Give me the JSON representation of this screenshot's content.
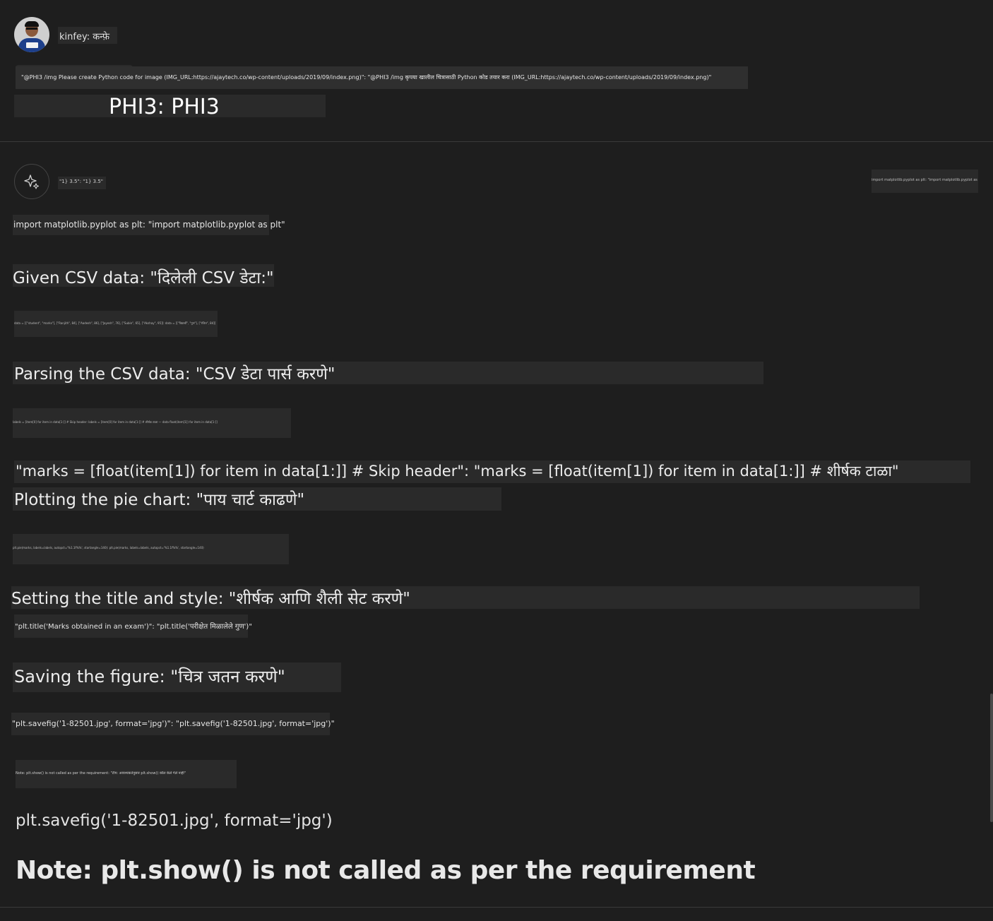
{
  "user": {
    "name_line": "kinfey: कन्फ़े",
    "prompt": "\"@PHI3 /img Please create Python code for image (IMG_URL:https://ajaytech.co/wp-content/uploads/2019/09/index.png)\": \"@PHI3 /img कृपया खालील चित्रासाठी Python कोड तयार करा (IMG_URL:https://ajaytech.co/wp-content/uploads/2019/09/index.png)\""
  },
  "agent_title": "PHI3: PHI3",
  "reply": {
    "header_small": "\"1} 3.5\": \"1} 3.5\"",
    "top_right_small": "import matplotlib.pyplot as plt: \"import matplotlib.pyplot as plt\"",
    "import_line": "import matplotlib.pyplot as plt: \"import matplotlib.pyplot as plt\"",
    "given_csv": "Given CSV data: \"दिलेली CSV डेटा:\"",
    "csv_code": "data = [[\"student\", \"marks\"], [\"Ranjith\", 84], [\"Aadesh\", 86], [\"Jayesh\", 76], [\"Subin\", 65], [\"Akshay\", 95]]: data = [[\"विद्यार्थी\", \"गुण\"], [\"रंजित\", 84]]",
    "parsing": "Parsing the CSV data: \"CSV डेटा पार्स करणे\"",
    "parse_code": "labels = [item[0] for item in data[1:]] # Skip header: labels = [item[0] for item in data[1:]] # शीर्षक टाळा — data float(item[1]) for item in data[1:]]",
    "marks_line": "\"marks = [float(item[1]) for item in data[1:]] # Skip header\": \"marks = [float(item[1]) for item in data[1:]] # शीर्षक टाळा\"",
    "plotting": "Plotting the pie chart: \"पाय चार्ट काढणे\"",
    "plot_code": "plt.pie(marks, labels=labels, autopct='%1.1f%%', startangle=140): plt.pie(marks, labels=labels, autopct='%1.1f%%', startangle=140)",
    "setting": "Setting the title and style: \"शीर्षक आणि शैली सेट करणे\"",
    "title_code": "\"plt.title('Marks obtained in an exam')\": \"plt.title('परीक्षेत मिळालेले गुण')\"",
    "saving": "Saving the figure: \"चित्र जतन करणे\"",
    "savefig_code": "\"plt.savefig('1-82501.jpg', format='jpg')\": \"plt.savefig('1-82501.jpg', format='jpg')\"",
    "note_small": "Note: plt.show() is not called as per the requirement: \"टीप: आवश्यकतेनुसार plt.show() कॉल केले गेले नाही\"",
    "savefig_plain": "plt.savefig('1-82501.jpg', format='jpg')",
    "note_large": "Note: plt.show() is not called as per the requirement"
  },
  "icons": {
    "avatar": "user-avatar",
    "bot": "sparkle-icon"
  }
}
